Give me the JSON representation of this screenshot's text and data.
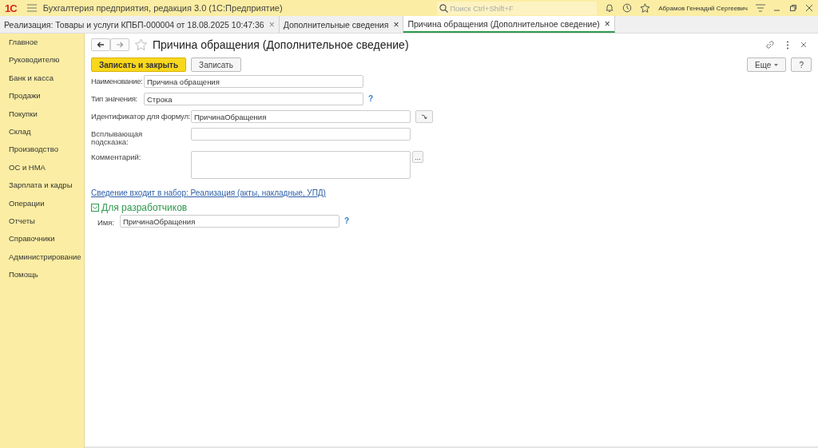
{
  "app_bar": {
    "logo": "1С",
    "title": "Бухгалтерия предприятия, редакция 3.0  (1С:Предприятие)",
    "search": {
      "placeholder": "Поиск Ctrl+Shift+F"
    },
    "user": "Абрамов Геннадий Сергеевич"
  },
  "tabs": [
    {
      "label": "Реализация: Товары и услуги КПБП-000004 от 18.08.2025 10:47:36",
      "selected": false,
      "close": "×"
    },
    {
      "label": "Дополнительные сведения",
      "selected": false,
      "close": "×"
    },
    {
      "label": "Причина обращения (Дополнительное сведение)",
      "selected": true,
      "close": "×"
    }
  ],
  "sidebar": {
    "items": [
      {
        "label": "Главное"
      },
      {
        "label": "Руководителю"
      },
      {
        "label": "Банк и касса"
      },
      {
        "label": "Продажи"
      },
      {
        "label": "Покупки"
      },
      {
        "label": "Склад"
      },
      {
        "label": "Производство"
      },
      {
        "label": "ОС и НМА"
      },
      {
        "label": "Зарплата и кадры"
      },
      {
        "label": "Операции"
      },
      {
        "label": "Отчеты"
      },
      {
        "label": "Справочники"
      },
      {
        "label": "Администрирование"
      },
      {
        "label": "Помощь"
      }
    ]
  },
  "form": {
    "title": "Причина обращения (Дополнительное сведение)",
    "buttons": [
      {
        "label": "Записать и закрыть",
        "kind": "primary"
      },
      {
        "label": "Записать",
        "kind": "normal"
      }
    ],
    "more_button": "Еще",
    "help_button": "?",
    "main_fields": [
      {
        "label": "Наименование:",
        "value": "Причина обращения"
      },
      {
        "label": "Тип значения:",
        "value": "Строка",
        "help": "?"
      }
    ],
    "extra_fields": [
      {
        "label": "Идентификатор для формул:",
        "value": "ПричинаОбращения",
        "kind": "action"
      },
      {
        "label": "Всплывающая подсказка:",
        "kind": "plain"
      },
      {
        "label": "Комментарий:",
        "kind": "multiline",
        "ellipsis": "..."
      }
    ],
    "set_link": "Сведение входит в набор: Реализация (акты, накладные, УПД)",
    "developers": {
      "title": "Для разработчиков",
      "expanded": true,
      "name_label": "Имя:",
      "name_value": "ПричинаОбращения",
      "help": "?"
    }
  }
}
